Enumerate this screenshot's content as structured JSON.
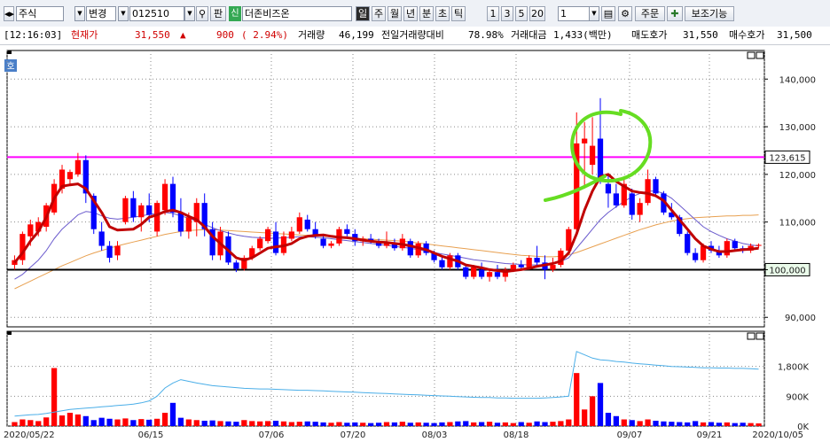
{
  "toolbar": {
    "market_select": "주식",
    "change_label": "변경",
    "code_value": "012510",
    "pan_label": "판",
    "new_badge": "신",
    "stock_name": "더존비즈온",
    "periods": [
      "일",
      "주",
      "월",
      "년",
      "분",
      "초",
      "틱"
    ],
    "active_period": "일",
    "num_buttons": [
      "1",
      "3",
      "5",
      "20"
    ],
    "interval_value": "1",
    "order_label": "주문",
    "aux_label": "보조기능"
  },
  "info": {
    "time": "[12:16:03]",
    "price_label": "현재가",
    "price": "31,550",
    "arrow": "▲",
    "change": "900",
    "change_pct": "( 2.94%)",
    "volume_label": "거래량",
    "volume": "46,199",
    "prev_ratio_label": "전일거래량대비",
    "prev_ratio": "78.98%",
    "amount_label": "거래대금",
    "amount": "1,433(백만)",
    "ask_label": "매도호가",
    "ask": "31,550",
    "bid_label": "매수호가",
    "bid": "31,500"
  },
  "chart": {
    "corner_label": "호",
    "price_axis": [
      "140,000",
      "130,000",
      "120,000",
      "110,000",
      "100,000",
      "90,000"
    ],
    "hline_magenta_label": "123,615",
    "hline_black_label": "100,000",
    "volume_axis": [
      "1,800K",
      "900K",
      "0K"
    ],
    "date_labels": [
      "2020/05/22",
      "06/15",
      "07/06",
      "07/20",
      "08/03",
      "08/18",
      "09/07",
      "09/21",
      "2020/10/05"
    ],
    "colors": {
      "up": "#ff0000",
      "down": "#0000ff",
      "ma5": "#c00000",
      "ma20": "#6a5acd",
      "ma60": "#e8a050",
      "magenta": "#ff00ff",
      "circle": "#66dd22",
      "vol_line": "#4aaee8"
    }
  },
  "chart_data": {
    "type": "candlestick",
    "price_ylim": [
      88000,
      146000
    ],
    "reference_lines": [
      123615,
      100000
    ],
    "candles": [
      {
        "o": 101000,
        "h": 103000,
        "l": 100000,
        "c": 102000
      },
      {
        "o": 102000,
        "h": 108000,
        "l": 101000,
        "c": 107500
      },
      {
        "o": 107000,
        "h": 110500,
        "l": 105000,
        "c": 109500
      },
      {
        "o": 108000,
        "h": 111000,
        "l": 107000,
        "c": 110000
      },
      {
        "o": 109000,
        "h": 114000,
        "l": 108000,
        "c": 113500
      },
      {
        "o": 112000,
        "h": 119000,
        "l": 111500,
        "c": 118000
      },
      {
        "o": 117000,
        "h": 122000,
        "l": 116000,
        "c": 121000
      },
      {
        "o": 119000,
        "h": 121000,
        "l": 118000,
        "c": 120500
      },
      {
        "o": 120000,
        "h": 124500,
        "l": 119500,
        "c": 123000
      },
      {
        "o": 123000,
        "h": 124000,
        "l": 114000,
        "c": 116000
      },
      {
        "o": 115500,
        "h": 116000,
        "l": 107500,
        "c": 108500
      },
      {
        "o": 108000,
        "h": 110000,
        "l": 104000,
        "c": 105000
      },
      {
        "o": 105000,
        "h": 106000,
        "l": 101500,
        "c": 102500
      },
      {
        "o": 103000,
        "h": 106000,
        "l": 102000,
        "c": 105000
      },
      {
        "o": 110000,
        "h": 115500,
        "l": 109500,
        "c": 115000
      },
      {
        "o": 115000,
        "h": 116500,
        "l": 110000,
        "c": 111000
      },
      {
        "o": 111000,
        "h": 114000,
        "l": 108000,
        "c": 113500
      },
      {
        "o": 113500,
        "h": 116000,
        "l": 110000,
        "c": 111500
      },
      {
        "o": 108000,
        "h": 114500,
        "l": 107000,
        "c": 114000
      },
      {
        "o": 112500,
        "h": 119000,
        "l": 111500,
        "c": 118000
      },
      {
        "o": 118000,
        "h": 119500,
        "l": 111000,
        "c": 112000
      },
      {
        "o": 112000,
        "h": 115000,
        "l": 107000,
        "c": 108000
      },
      {
        "o": 108000,
        "h": 112000,
        "l": 106500,
        "c": 111000
      },
      {
        "o": 110000,
        "h": 115000,
        "l": 107000,
        "c": 114000
      },
      {
        "o": 114000,
        "h": 116000,
        "l": 107000,
        "c": 108500
      },
      {
        "o": 108500,
        "h": 110000,
        "l": 102000,
        "c": 103000
      },
      {
        "o": 103000,
        "h": 109000,
        "l": 102000,
        "c": 108000
      },
      {
        "o": 107000,
        "h": 108000,
        "l": 101000,
        "c": 101500
      },
      {
        "o": 101500,
        "h": 102000,
        "l": 99500,
        "c": 100200
      },
      {
        "o": 100200,
        "h": 103000,
        "l": 99800,
        "c": 102500
      },
      {
        "o": 102500,
        "h": 105000,
        "l": 102000,
        "c": 104500
      },
      {
        "o": 104500,
        "h": 107000,
        "l": 104000,
        "c": 106500
      },
      {
        "o": 106000,
        "h": 109000,
        "l": 105500,
        "c": 108500
      },
      {
        "o": 108000,
        "h": 110000,
        "l": 103000,
        "c": 103500
      },
      {
        "o": 103500,
        "h": 108000,
        "l": 103000,
        "c": 107000
      },
      {
        "o": 106500,
        "h": 109000,
        "l": 106000,
        "c": 108000
      },
      {
        "o": 108000,
        "h": 112000,
        "l": 107500,
        "c": 111000
      },
      {
        "o": 110500,
        "h": 111500,
        "l": 108000,
        "c": 108500
      },
      {
        "o": 108500,
        "h": 110000,
        "l": 106500,
        "c": 107000
      },
      {
        "o": 106500,
        "h": 107500,
        "l": 104500,
        "c": 105000
      },
      {
        "o": 105000,
        "h": 106000,
        "l": 104500,
        "c": 105500
      },
      {
        "o": 105500,
        "h": 109000,
        "l": 105000,
        "c": 108500
      },
      {
        "o": 108500,
        "h": 109500,
        "l": 107000,
        "c": 107500
      },
      {
        "o": 107500,
        "h": 108500,
        "l": 105000,
        "c": 106000
      },
      {
        "o": 106000,
        "h": 107000,
        "l": 105000,
        "c": 106500
      },
      {
        "o": 106500,
        "h": 107500,
        "l": 105500,
        "c": 106000
      },
      {
        "o": 106000,
        "h": 106500,
        "l": 104500,
        "c": 105000
      },
      {
        "o": 105000,
        "h": 108000,
        "l": 104500,
        "c": 105500
      },
      {
        "o": 105500,
        "h": 106500,
        "l": 104000,
        "c": 104500
      },
      {
        "o": 104500,
        "h": 107500,
        "l": 104000,
        "c": 106500
      },
      {
        "o": 106000,
        "h": 106500,
        "l": 102500,
        "c": 103000
      },
      {
        "o": 103000,
        "h": 106000,
        "l": 102500,
        "c": 105500
      },
      {
        "o": 105500,
        "h": 106000,
        "l": 103000,
        "c": 103500
      },
      {
        "o": 103500,
        "h": 104000,
        "l": 101500,
        "c": 102000
      },
      {
        "o": 102000,
        "h": 102500,
        "l": 100000,
        "c": 100500
      },
      {
        "o": 100500,
        "h": 103500,
        "l": 100000,
        "c": 103000
      },
      {
        "o": 103000,
        "h": 103500,
        "l": 100000,
        "c": 100500
      },
      {
        "o": 100500,
        "h": 101000,
        "l": 98000,
        "c": 98500
      },
      {
        "o": 98500,
        "h": 101000,
        "l": 98000,
        "c": 100500
      },
      {
        "o": 100000,
        "h": 101500,
        "l": 98000,
        "c": 98500
      },
      {
        "o": 98500,
        "h": 100000,
        "l": 97500,
        "c": 99500
      },
      {
        "o": 99500,
        "h": 101000,
        "l": 98000,
        "c": 98500
      },
      {
        "o": 98500,
        "h": 100500,
        "l": 97500,
        "c": 100000
      },
      {
        "o": 100000,
        "h": 101500,
        "l": 99500,
        "c": 101000
      },
      {
        "o": 101000,
        "h": 102000,
        "l": 100000,
        "c": 100500
      },
      {
        "o": 100500,
        "h": 103000,
        "l": 100000,
        "c": 102500
      },
      {
        "o": 102500,
        "h": 105000,
        "l": 101000,
        "c": 101500
      },
      {
        "o": 101500,
        "h": 103000,
        "l": 98000,
        "c": 100000
      },
      {
        "o": 100000,
        "h": 102500,
        "l": 99500,
        "c": 101000
      },
      {
        "o": 101000,
        "h": 104500,
        "l": 100500,
        "c": 104000
      },
      {
        "o": 104000,
        "h": 109000,
        "l": 103500,
        "c": 108500
      },
      {
        "o": 108500,
        "h": 133000,
        "l": 108000,
        "c": 126500
      },
      {
        "o": 126500,
        "h": 131000,
        "l": 117000,
        "c": 127500
      },
      {
        "o": 122000,
        "h": 132000,
        "l": 120000,
        "c": 126000
      },
      {
        "o": 127500,
        "h": 136000,
        "l": 118000,
        "c": 119000
      },
      {
        "o": 118000,
        "h": 120000,
        "l": 113000,
        "c": 116000
      },
      {
        "o": 116000,
        "h": 118000,
        "l": 113000,
        "c": 113500
      },
      {
        "o": 113500,
        "h": 119000,
        "l": 113000,
        "c": 118000
      },
      {
        "o": 116000,
        "h": 117000,
        "l": 110500,
        "c": 111500
      },
      {
        "o": 111500,
        "h": 115000,
        "l": 110000,
        "c": 114000
      },
      {
        "o": 114000,
        "h": 121000,
        "l": 113500,
        "c": 119000
      },
      {
        "o": 119000,
        "h": 119500,
        "l": 115500,
        "c": 116000
      },
      {
        "o": 116000,
        "h": 116500,
        "l": 111500,
        "c": 112000
      },
      {
        "o": 112000,
        "h": 114000,
        "l": 110500,
        "c": 111000
      },
      {
        "o": 111000,
        "h": 111500,
        "l": 107000,
        "c": 107500
      },
      {
        "o": 107500,
        "h": 108000,
        "l": 103000,
        "c": 103500
      },
      {
        "o": 103500,
        "h": 104500,
        "l": 101500,
        "c": 102000
      },
      {
        "o": 102000,
        "h": 105500,
        "l": 101500,
        "c": 105000
      },
      {
        "o": 105000,
        "h": 106000,
        "l": 103500,
        "c": 104000
      },
      {
        "o": 104000,
        "h": 105000,
        "l": 102500,
        "c": 103000
      },
      {
        "o": 103000,
        "h": 106500,
        "l": 102500,
        "c": 106000
      },
      {
        "o": 106000,
        "h": 106500,
        "l": 104000,
        "c": 104500
      },
      {
        "o": 104500,
        "h": 105000,
        "l": 103500,
        "c": 104000
      },
      {
        "o": 104000,
        "h": 105500,
        "l": 103500,
        "c": 105000
      },
      {
        "o": 105000,
        "h": 105500,
        "l": 104500,
        "c": 105200
      }
    ],
    "volumes_k": [
      120,
      200,
      180,
      150,
      260,
      1750,
      320,
      400,
      350,
      300,
      180,
      250,
      220,
      200,
      230,
      180,
      210,
      190,
      220,
      400,
      700,
      250,
      200,
      180,
      160,
      170,
      150,
      140,
      130,
      180,
      150,
      140,
      150,
      160,
      140,
      120,
      130,
      140,
      130,
      110,
      100,
      120,
      100,
      110,
      100,
      90,
      100,
      120,
      110,
      130,
      100,
      110,
      100,
      90,
      110,
      120,
      140,
      150,
      110,
      120,
      130,
      100,
      110,
      90,
      120,
      100,
      140,
      120,
      130,
      150,
      200,
      1600,
      500,
      900,
      1300,
      400,
      300,
      200,
      180,
      150,
      200,
      160,
      140,
      130,
      120,
      110,
      150,
      110,
      120,
      100,
      110,
      90,
      100,
      90,
      80
    ],
    "volume_ylim": [
      0,
      2700
    ],
    "ma5": [
      101500,
      103500,
      106000,
      108000,
      111000,
      115000,
      117500,
      117800,
      118000,
      117000,
      114500,
      112000,
      109000,
      108300,
      108400,
      108500,
      109500,
      111000,
      111500,
      112200,
      112500,
      112000,
      111200,
      110500,
      109000,
      107000,
      105500,
      104000,
      102500,
      102000,
      102500,
      103500,
      104500,
      104800,
      105000,
      105500,
      106500,
      107000,
      107200,
      107300,
      107000,
      106800,
      106700,
      106500,
      106200,
      106000,
      105800,
      105700,
      105500,
      105300,
      105000,
      104600,
      104200,
      103500,
      102800,
      102300,
      101800,
      101000,
      100700,
      100400,
      100000,
      99800,
      99600,
      99800,
      100000,
      100300,
      100700,
      101000,
      101300,
      101800,
      103500,
      107500,
      112500,
      116500,
      119500,
      120000,
      118500,
      117500,
      116500,
      116200,
      116000,
      115500,
      114500,
      112500,
      110500,
      108500,
      106500,
      105000,
      104300,
      103800,
      103800,
      104000,
      104200,
      104300,
      104500
    ],
    "ma20": [
      98000,
      99000,
      100500,
      102000,
      104000,
      106500,
      108500,
      110000,
      111500,
      112200,
      112000,
      111300,
      110800,
      110600,
      110800,
      111000,
      111300,
      111600,
      111800,
      112000,
      111800,
      111300,
      110800,
      110200,
      109500,
      108800,
      108200,
      107700,
      107300,
      107000,
      106800,
      106700,
      106600,
      106600,
      106700,
      106800,
      106900,
      106900,
      106800,
      106700,
      106500,
      106300,
      106100,
      105900,
      105700,
      105500,
      105300,
      105100,
      104900,
      104700,
      104500,
      104200,
      103900,
      103600,
      103300,
      103000,
      102700,
      102400,
      102100,
      101900,
      101700,
      101500,
      101300,
      101200,
      101100,
      101000,
      101000,
      101100,
      101300,
      101700,
      102500,
      104500,
      106500,
      108500,
      110500,
      112000,
      113200,
      114300,
      115300,
      116000,
      116500,
      116500,
      116000,
      115000,
      113500,
      112000,
      110500,
      109000,
      108000,
      107200,
      106500,
      106000,
      105500,
      105200,
      105000
    ],
    "ma60": [
      96000,
      96800,
      97600,
      98400,
      99200,
      100000,
      100800,
      101500,
      102200,
      102900,
      103500,
      104000,
      104500,
      105000,
      105400,
      105800,
      106200,
      106600,
      107000,
      107400,
      107700,
      108000,
      108200,
      108300,
      108400,
      108400,
      108300,
      108200,
      108100,
      108000,
      107900,
      107800,
      107700,
      107600,
      107500,
      107400,
      107300,
      107200,
      107100,
      107000,
      106900,
      106800,
      106700,
      106600,
      106500,
      106400,
      106300,
      106200,
      106100,
      106000,
      105800,
      105600,
      105400,
      105200,
      105000,
      104800,
      104600,
      104400,
      104200,
      104000,
      103800,
      103600,
      103400,
      103200,
      103000,
      102900,
      102800,
      102700,
      102700,
      102800,
      103100,
      103600,
      104200,
      104800,
      105400,
      106000,
      106600,
      107200,
      107800,
      108400,
      108900,
      109400,
      109800,
      110200,
      110500,
      110700,
      110900,
      111000,
      111100,
      111200,
      111300,
      111300,
      111400,
      111400,
      111500
    ],
    "volume_line_k": [
      300,
      320,
      340,
      350,
      380,
      420,
      460,
      500,
      520,
      540,
      560,
      580,
      600,
      620,
      640,
      660,
      700,
      760,
      900,
      1150,
      1300,
      1400,
      1350,
      1300,
      1260,
      1220,
      1200,
      1180,
      1160,
      1140,
      1130,
      1120,
      1120,
      1110,
      1100,
      1090,
      1080,
      1080,
      1070,
      1060,
      1050,
      1040,
      1030,
      1020,
      1010,
      1000,
      990,
      980,
      970,
      960,
      950,
      940,
      930,
      920,
      910,
      900,
      890,
      880,
      870,
      860,
      860,
      850,
      850,
      840,
      840,
      840,
      840,
      850,
      860,
      880,
      900,
      2250,
      2150,
      2050,
      2000,
      1980,
      1950,
      1930,
      1900,
      1880,
      1860,
      1840,
      1820,
      1800,
      1790,
      1780,
      1770,
      1760,
      1760,
      1750,
      1750,
      1740,
      1740,
      1730,
      1720
    ]
  }
}
